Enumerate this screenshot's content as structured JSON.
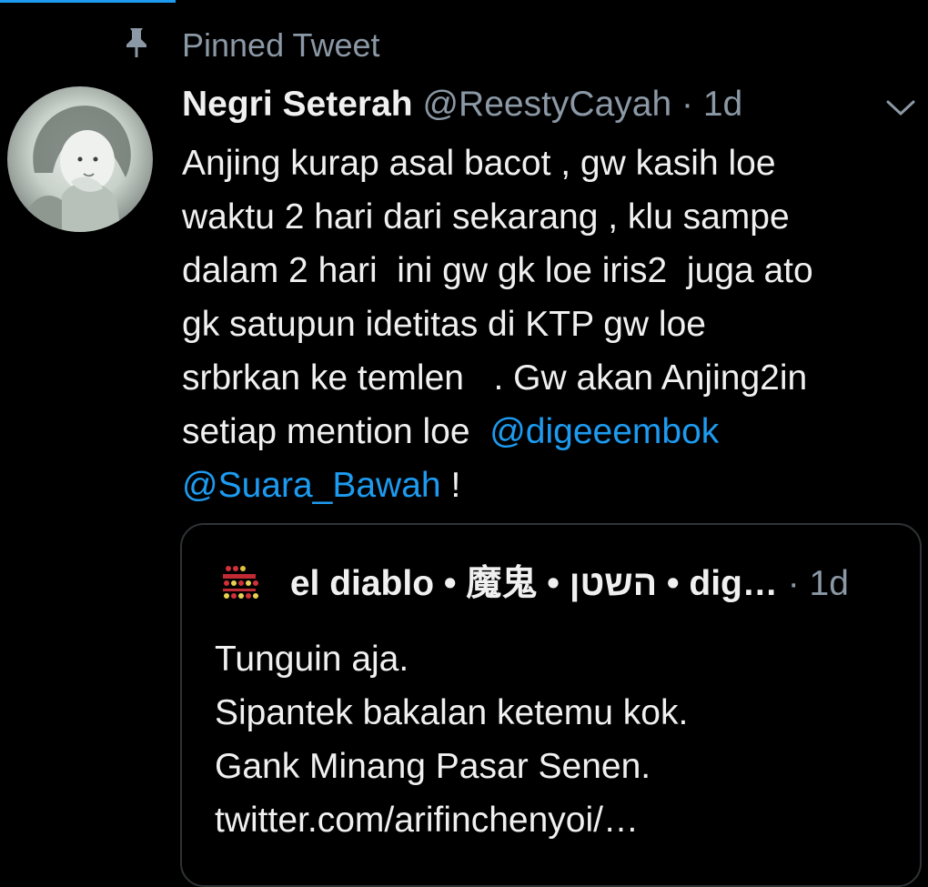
{
  "pinned": {
    "icon": "pin-icon",
    "label": "Pinned Tweet"
  },
  "tweet": {
    "author_name": "Negri Seterah",
    "author_handle": "@ReestyCayah",
    "separator": "·",
    "time": "1d",
    "menu_icon": "chevron-down-icon",
    "lines": [
      "Anjing kurap asal bacot , gw kasih loe",
      "waktu 2 hari dari sekarang , klu sampe",
      "dalam 2 hari  ini gw gk loe iris2  juga ato",
      "gk satupun idetitas di KTP gw loe",
      "srbrkan ke temlen   . Gw akan Anjing2in"
    ],
    "line6_text": "setiap mention loe  ",
    "mention1": "@digeeembok",
    "mention2": "@Suara_Bawah",
    "line7_suffix": " !"
  },
  "quote": {
    "author_name": "el diablo • 魔鬼 • השטן • dig…",
    "separator": "·",
    "time": "1d",
    "lines": [
      "Tunguin aja.",
      "Sipantek bakalan ketemu kok.",
      "Gank Minang Pasar Senen.",
      "twitter.com/arifinchenyoi/…"
    ]
  },
  "colors": {
    "background": "#000000",
    "text": "#e7e9ea",
    "secondary": "#8b98a5",
    "link": "#1d9bf0",
    "border": "#2f3336"
  }
}
